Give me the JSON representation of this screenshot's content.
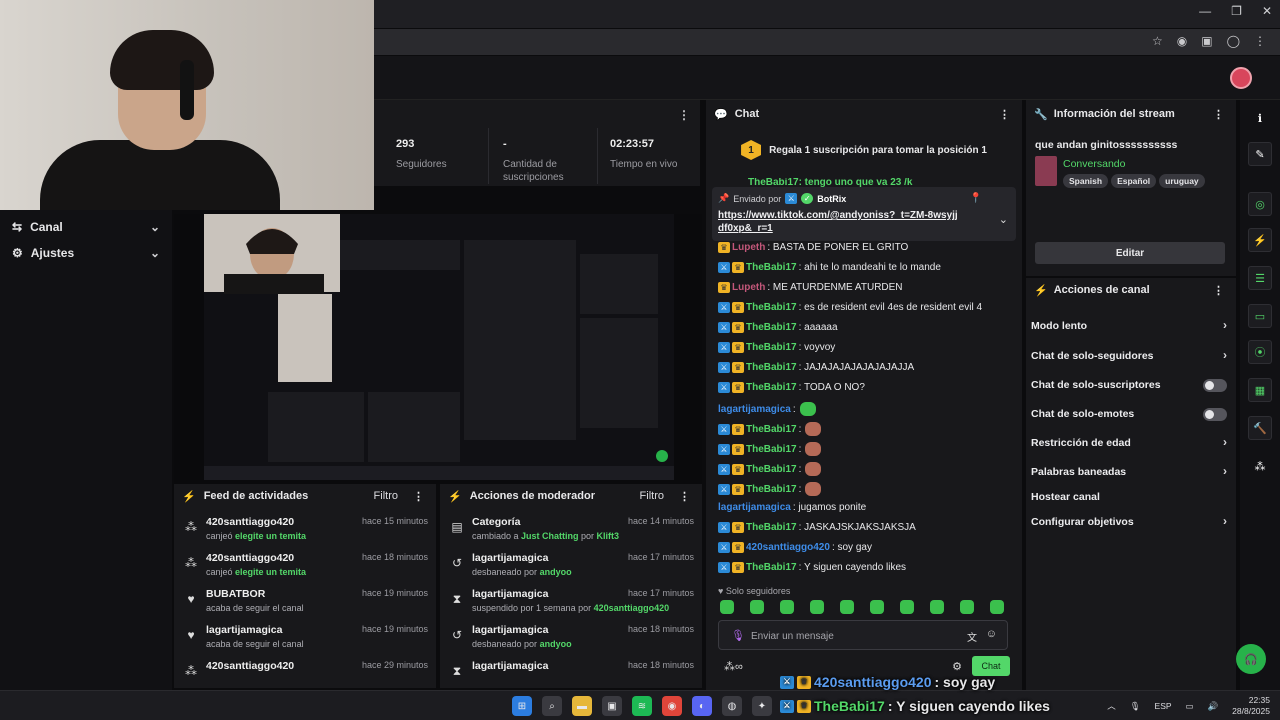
{
  "stats": {
    "followers_value": "293",
    "followers_label": "Seguidores",
    "subs_value": "-",
    "subs_label": "Cantidad de suscripciones",
    "live_value": "02:23:57",
    "live_label": "Tiempo en vivo"
  },
  "nav": {
    "canal": "Canal",
    "ajustes": "Ajustes"
  },
  "feed": {
    "title": "Feed de actividades",
    "filter": "Filtro",
    "items": [
      {
        "user": "420santtiaggo420",
        "pre": "canjeó ",
        "highlight": "elegite un temita",
        "time": "hace 15 minutos",
        "icon": "redeem-icon"
      },
      {
        "user": "420santtiaggo420",
        "pre": "canjeó ",
        "highlight": "elegite un temita",
        "time": "hace 18 minutos",
        "icon": "redeem-icon"
      },
      {
        "user": "BUBATBOR",
        "pre": "acaba de seguir el canal",
        "highlight": "",
        "time": "hace 19 minutos",
        "icon": "heart-icon"
      },
      {
        "user": "lagartijamagica",
        "pre": "acaba de seguir el canal",
        "highlight": "",
        "time": "hace 19 minutos",
        "icon": "heart-icon"
      },
      {
        "user": "420santtiaggo420",
        "pre": "",
        "highlight": "",
        "time": "hace 29 minutos",
        "icon": "redeem-icon"
      }
    ]
  },
  "modactions": {
    "title": "Acciones de moderador",
    "filter": "Filtro",
    "items": [
      {
        "title": "Categoría",
        "pre": "cambiado a ",
        "h1": "Just Chatting",
        "mid": " por ",
        "h2": "Klift3",
        "time": "hace 14 minutos",
        "icon": "category-icon"
      },
      {
        "title": "lagartijamagica",
        "pre": "desbaneado por ",
        "h1": "andyoo",
        "mid": "",
        "h2": "",
        "time": "hace 17 minutos",
        "icon": "unban-icon"
      },
      {
        "title": "lagartijamagica",
        "pre": "suspendido por 1 semana por ",
        "h1": "420santtiaggo420",
        "mid": "",
        "h2": "",
        "time": "hace 17 minutos",
        "icon": "timeout-icon"
      },
      {
        "title": "lagartijamagica",
        "pre": "desbaneado por ",
        "h1": "andyoo",
        "mid": "",
        "h2": "",
        "time": "hace 18 minutos",
        "icon": "unban-icon"
      },
      {
        "title": "lagartijamagica",
        "pre": "",
        "h1": "",
        "mid": "",
        "h2": "",
        "time": "hace 18 minutos",
        "icon": "timeout-icon"
      }
    ]
  },
  "chat": {
    "title": "Chat",
    "banner_rank": "1",
    "banner_text": "Regala 1 suscripción para tomar la posición 1",
    "pinned_prefix": "Enviado por",
    "pinned_user": "BotRix",
    "pinned_link": "https://www.tiktok.com/@andyoniss?_t=ZM-8wsyjjdf0xp&_r=1",
    "partial_top": "TheBabi17: tengo uno que va 23 /k",
    "messages": [
      {
        "user": "Lupeth",
        "cls": "u2",
        "badges": [
          "c"
        ],
        "text": ": BASTA DE PONER EL GRITO",
        "emotes": 0
      },
      {
        "user": "TheBabi17",
        "cls": "u1",
        "badges": [
          "m",
          "c"
        ],
        "text": ": ahi te lo mandeahi te lo mande",
        "emotes": 0
      },
      {
        "user": "Lupeth",
        "cls": "u2",
        "badges": [
          "c"
        ],
        "text": ": ME ATURDENME ATURDEN",
        "emotes": 0
      },
      {
        "user": "TheBabi17",
        "cls": "u1",
        "badges": [
          "m",
          "c"
        ],
        "text": ": es de resident evil 4es de resident evil 4",
        "emotes": 0
      },
      {
        "user": "TheBabi17",
        "cls": "u1",
        "badges": [
          "m",
          "c"
        ],
        "text": ": aaaaaa",
        "emotes": 0
      },
      {
        "user": "TheBabi17",
        "cls": "u1",
        "badges": [
          "m",
          "c"
        ],
        "text": ": voyvoy",
        "emotes": 0
      },
      {
        "user": "TheBabi17",
        "cls": "u1",
        "badges": [
          "m",
          "c"
        ],
        "text": ": JAJAJAJAJAJAJAJAJJA",
        "emotes": 0
      },
      {
        "user": "TheBabi17",
        "cls": "u1",
        "badges": [
          "m",
          "c"
        ],
        "text": ": TODA O NO?",
        "emotes": 0
      },
      {
        "user": "lagartijamagica",
        "cls": "u3",
        "badges": [],
        "text": ":",
        "emotes": 1,
        "green": true
      },
      {
        "user": "TheBabi17",
        "cls": "u1",
        "badges": [
          "m",
          "c"
        ],
        "text": ":",
        "emotes": 1
      },
      {
        "user": "TheBabi17",
        "cls": "u1",
        "badges": [
          "m",
          "c"
        ],
        "text": ":",
        "emotes": 1
      },
      {
        "user": "TheBabi17",
        "cls": "u1",
        "badges": [
          "m",
          "c"
        ],
        "text": ":",
        "emotes": 1
      },
      {
        "user": "TheBabi17",
        "cls": "u1",
        "badges": [
          "m",
          "c"
        ],
        "text": ":",
        "emotes": 1
      },
      {
        "user": "lagartijamagica",
        "cls": "u3",
        "badges": [],
        "text": ": jugamos ponite",
        "emotes": 0
      },
      {
        "user": "TheBabi17",
        "cls": "u1",
        "badges": [
          "m",
          "c"
        ],
        "text": ": JASKAJSKJAKSJAKSJA",
        "emotes": 0
      },
      {
        "user": "420santtiaggo420",
        "cls": "u3",
        "badges": [
          "m",
          "c"
        ],
        "text": ": soy gay",
        "emotes": 0
      },
      {
        "user": "TheBabi17",
        "cls": "u1",
        "badges": [
          "m",
          "c"
        ],
        "text": ": Y siguen cayendo likes",
        "emotes": 0
      }
    ],
    "slow_tag": "Solo seguidores",
    "input_placeholder": "Enviar un mensaje",
    "send_label": "Chat"
  },
  "info": {
    "title": "Información del stream",
    "stream_title": "que andan ginitossssssssss",
    "category": "Conversando",
    "tags": [
      "Spanish",
      "Español",
      "uruguay"
    ],
    "edit_label": "Editar"
  },
  "actions": {
    "title": "Acciones de canal",
    "rows": [
      {
        "label": "Modo lento",
        "kind": "arrow"
      },
      {
        "label": "Chat de solo-seguidores",
        "kind": "arrow"
      },
      {
        "label": "Chat de solo-suscriptores",
        "kind": "toggle"
      },
      {
        "label": "Chat de solo-emotes",
        "kind": "toggle"
      },
      {
        "label": "Restricción de edad",
        "kind": "arrow"
      },
      {
        "label": "Palabras baneadas",
        "kind": "arrow"
      },
      {
        "label": "Hostear canal",
        "kind": "none"
      },
      {
        "label": "Configurar objetivos",
        "kind": "arrow"
      }
    ]
  },
  "overlay": [
    {
      "user": "420santtiaggo420",
      "text": ": soy gay",
      "color": "#5b9cf0"
    },
    {
      "user": "TheBabi17",
      "text": ": Y siguen cayendo likes",
      "color": "#53d769"
    }
  ],
  "taskbar": {
    "lang": "ESP",
    "time": "22:35",
    "date": "28/8/2025"
  },
  "colors": {
    "accent": "#53d769",
    "panel": "#18181b",
    "background": "#0b0b0d"
  }
}
